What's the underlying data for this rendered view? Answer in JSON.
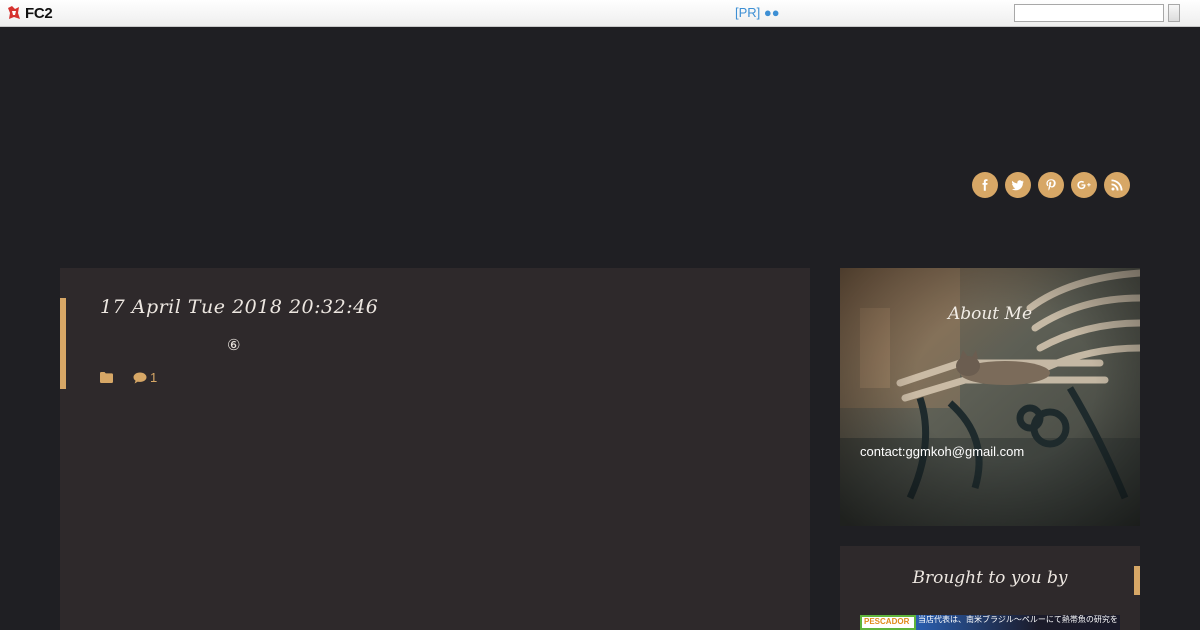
{
  "fc2_bar": {
    "logo_text": "FC2",
    "pr_label": "[PR]",
    "pr_dots": "●●",
    "search_value": ""
  },
  "social": [
    {
      "name": "facebook-icon",
      "glyph": "f"
    },
    {
      "name": "twitter-icon",
      "glyph": "t"
    },
    {
      "name": "pinterest-icon",
      "glyph": "P"
    },
    {
      "name": "google-plus-icon",
      "glyph": "G+"
    },
    {
      "name": "rss-icon",
      "glyph": "rss"
    }
  ],
  "post": {
    "date": "17 April Tue 2018 20:32:46",
    "marker": "⑥",
    "comment_count": "1"
  },
  "sidebar": {
    "about_title": "About Me",
    "contact": "contact:ggmkoh@gmail.com",
    "sponsor_title": "Brought to you by",
    "sponsor_logo": "PESCADOR",
    "sponsor_text": "当店代表は、南米ブラジル～ペルーにて熱帯魚の研究を"
  },
  "colors": {
    "accent": "#d7a766",
    "background": "#1f1f23",
    "panel": "#2e292b"
  }
}
